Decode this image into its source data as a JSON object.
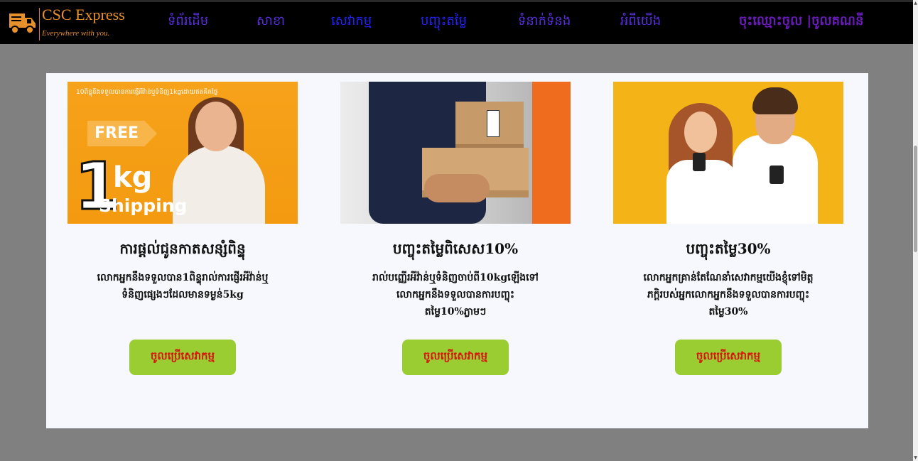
{
  "header": {
    "logo": {
      "title": "CSC Express",
      "tagline": "Everywhere with you."
    },
    "nav": [
      {
        "label": "ទំព័រដើម",
        "active": false
      },
      {
        "label": "សាខា",
        "active": false
      },
      {
        "label": "សេវាកម្ម",
        "active": true
      },
      {
        "label": "បញ្ចុះតម្លៃ",
        "active": true
      },
      {
        "label": "ទំនាក់ទំនង",
        "active": false
      },
      {
        "label": "អំពីយើង",
        "active": false
      }
    ],
    "auth": {
      "login": "ចុះឈ្មោះចូល",
      "separator": " |",
      "register": "ចូលគណនី"
    }
  },
  "cards": [
    {
      "image": {
        "topline": "10ពិន្ទុនឹងទទួលបានការផ្ញើអីវ៉ាន់ឬទំនិញ1kgដោយឥតគិតថ្លៃ",
        "free": "FREE",
        "one": "1",
        "kg": "kg",
        "shipping": "Shipping"
      },
      "title": "ការផ្តល់ជូនកាតសន្សំពិន្ទុ",
      "description": "លោកអ្នកនឹងទទួលបាន1ពិន្ទុរាល់ការផ្ញើរអីវ៉ាន់ឬទំនិញផ្សេងៗដែលមានទម្ងន់5kg",
      "button": "ចូលប្រើសេវាកម្ម"
    },
    {
      "title": "បញ្ចុះតម្លៃពិសេស10%",
      "description": "រាល់បញ្ញើរអីវ៉ាន់ឬទំនិញចាប់ពី10kgឡើងទៅលោកអ្នកនឹងទទួលបានការបញ្ចុះតម្លៃ10%ភ្លាមៗ",
      "button": "ចូលប្រើសេវាកម្ម"
    },
    {
      "title": "បញ្ចុះតម្លៃ30%",
      "description": "លោកអ្នកគ្រាន់តែណែនាំសេវាកម្មយើងខ្ញុំទៅមិត្តភក្តិរបស់អ្នកលោកអ្នកនឹងទទួលបានការបញ្ចុះតម្លៃ30%",
      "button": "ចូលប្រើសេវាកម្ម"
    }
  ],
  "colors": {
    "page_bg": "#808080",
    "header_bg": "#000000",
    "logo": "#e8902a",
    "nav": "#5a2ee0",
    "nav_active": "#2323ff",
    "button_bg": "#9acd32",
    "button_text": "#d8140c"
  }
}
